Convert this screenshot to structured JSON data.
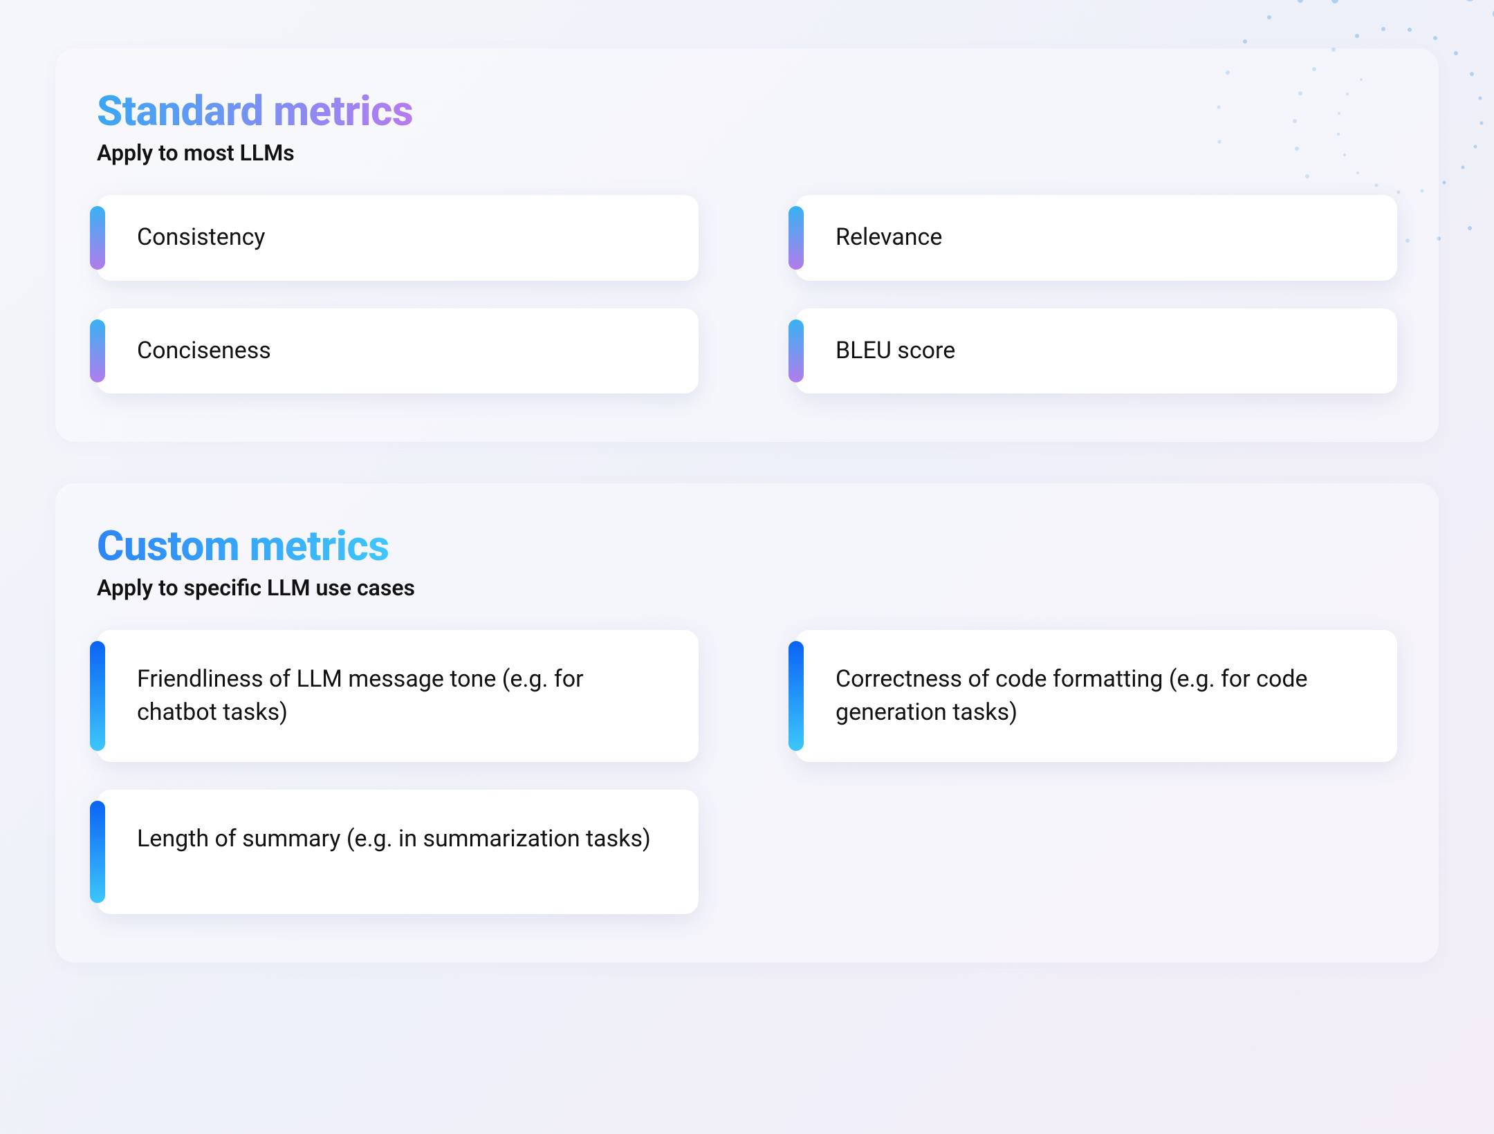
{
  "sections": [
    {
      "title": "Standard metrics",
      "subtitle": "Apply to most LLMs",
      "title_gradient": [
        "#3AA7F5",
        "#B77BF0"
      ],
      "edge_gradient": [
        "#38B2F2",
        "#B17CEB"
      ],
      "items": [
        "Consistency",
        "Relevance",
        "Conciseness",
        "BLEU score"
      ]
    },
    {
      "title": "Custom metrics",
      "subtitle": "Apply to specific LLM use cases",
      "title_gradient": [
        "#2F85F6",
        "#3FC7FB"
      ],
      "edge_gradient": [
        "#0A63F4",
        "#3DC7FB"
      ],
      "items": [
        "Friendliness of LLM message tone (e.g. for chatbot tasks)",
        "Correctness of code formatting (e.g. for code generation tasks)",
        "Length of summary (e.g. in summarization tasks)"
      ]
    }
  ]
}
